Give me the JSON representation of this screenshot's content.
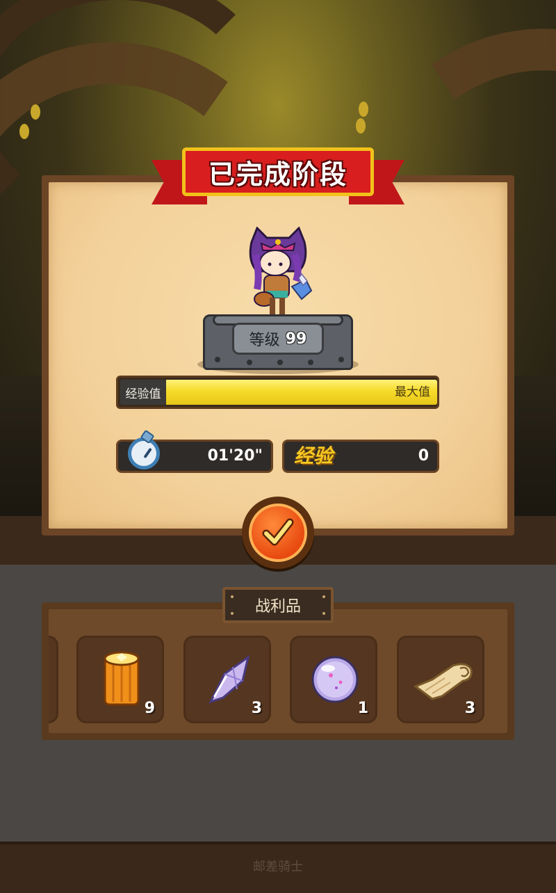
{
  "result": {
    "title": "已完成阶段",
    "level_label": "等级",
    "level_value": "99",
    "exp_bar": {
      "label": "经验值",
      "max_label": "最大值",
      "fill_fraction": 1.0
    },
    "time_value": "01'20\"",
    "exp_tag": "经验",
    "exp_value": "0"
  },
  "loot": {
    "title": "战利品",
    "items": [
      {
        "icon": "partial-item-icon",
        "count": ""
      },
      {
        "icon": "gold-log-icon",
        "count": "9"
      },
      {
        "icon": "crystal-shard-icon",
        "count": "3"
      },
      {
        "icon": "magic-orb-icon",
        "count": "1"
      },
      {
        "icon": "scroll-icon",
        "count": "3"
      }
    ]
  },
  "footer": {
    "text": "邮差骑士"
  },
  "colors": {
    "ribbon": "#d81e1e",
    "ribbon_border": "#f2c21a",
    "exp_fill": "#f6db2a",
    "confirm": "#e84a10"
  }
}
